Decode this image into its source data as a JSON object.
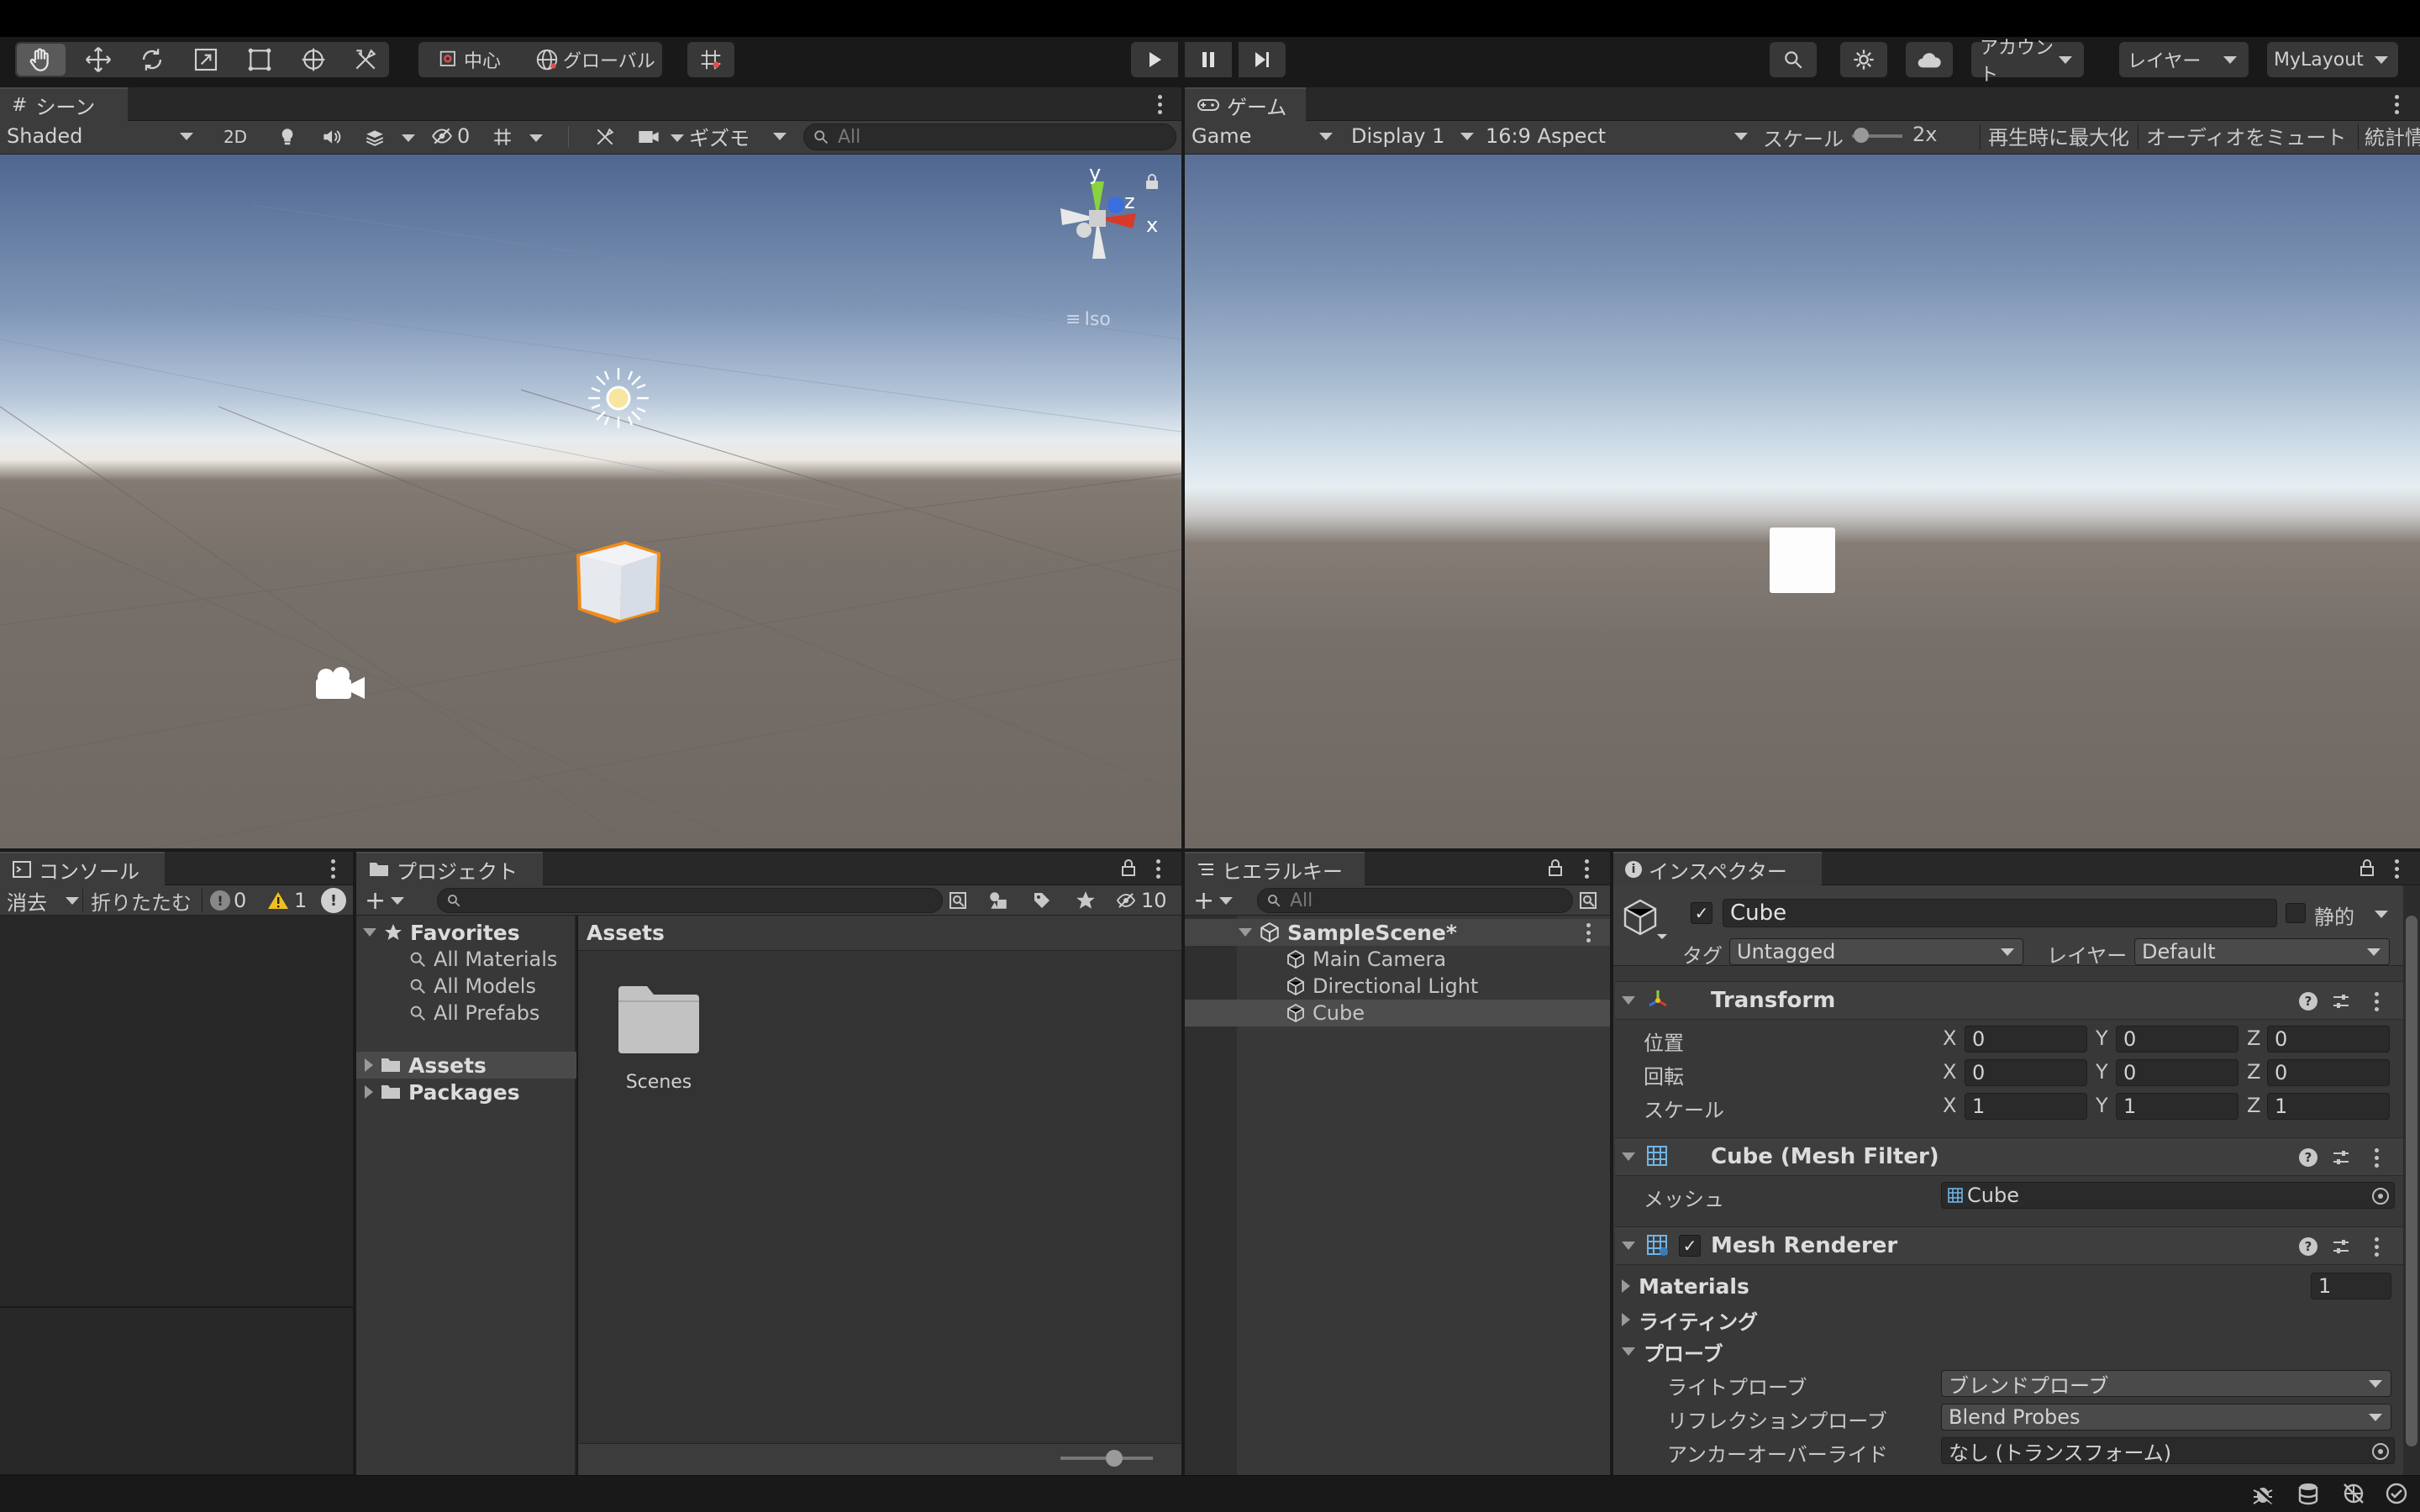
{
  "toolbar": {
    "pivot_label": "中心",
    "space_label": "グローバル",
    "account_label": "アカウント",
    "layers_label": "レイヤー",
    "layout_label": "MyLayout"
  },
  "scene": {
    "tab_label": "シーン",
    "shading_mode": "Shaded",
    "mode_2d": "2D",
    "hidden_count": "0",
    "gizmos_label": "ギズモ",
    "search_placeholder": "All",
    "gizmo_axes": {
      "x": "x",
      "y": "y",
      "z": "z"
    },
    "projection_label": "Iso"
  },
  "game": {
    "tab_label": "ゲーム",
    "view_label": "Game",
    "display_label": "Display 1",
    "aspect_label": "16:9 Aspect",
    "scale_label": "スケール",
    "scale_value": "2x",
    "maximize_label": "再生時に最大化",
    "mute_label": "オーディオをミュート",
    "stats_label": "統計情"
  },
  "console": {
    "tab_label": "コンソール",
    "clear_label": "消去",
    "collapse_label": "折りたたむ",
    "info_count": "0",
    "warning_count": "1"
  },
  "project": {
    "tab_label": "プロジェクト",
    "hidden_count": "10",
    "favorites_label": "Favorites",
    "favorites": [
      "All Materials",
      "All Models",
      "All Prefabs"
    ],
    "roots": [
      "Assets",
      "Packages"
    ],
    "breadcrumb": "Assets",
    "items": [
      {
        "name": "Scenes"
      }
    ]
  },
  "hierarchy": {
    "tab_label": "ヒエラルキー",
    "search_placeholder": "All",
    "scene_name": "SampleScene*",
    "objects": [
      "Main Camera",
      "Directional Light",
      "Cube"
    ]
  },
  "inspector": {
    "tab_label": "インスペクター",
    "object_name": "Cube",
    "static_label": "静的",
    "tag_label": "タグ",
    "tag_value": "Untagged",
    "layer_label": "レイヤー",
    "layer_value": "Default",
    "transform": {
      "title": "Transform",
      "position_label": "位置",
      "rotation_label": "回転",
      "scale_label": "スケール",
      "axes": [
        "X",
        "Y",
        "Z"
      ],
      "position": [
        "0",
        "0",
        "0"
      ],
      "rotation": [
        "0",
        "0",
        "0"
      ],
      "scale": [
        "1",
        "1",
        "1"
      ]
    },
    "mesh_filter": {
      "title": "Cube (Mesh Filter)",
      "mesh_label": "メッシュ",
      "mesh_value": "Cube"
    },
    "mesh_renderer": {
      "title": "Mesh Renderer",
      "materials_label": "Materials",
      "materials_count": "1",
      "lighting_label": "ライティング",
      "probes_label": "プローブ",
      "light_probes_label": "ライトプローブ",
      "light_probes_value": "ブレンドプローブ",
      "reflection_probes_label": "リフレクションプローブ",
      "reflection_probes_value": "Blend Probes",
      "anchor_override_label": "アンカーオーバーライド",
      "anchor_override_value": "なし (トランスフォーム)"
    }
  },
  "colors": {
    "accent_orange": "#f28c1a",
    "selection_blue": "#2c5d87",
    "axis_x": "#d83a2a",
    "axis_y": "#8ad23e",
    "axis_z": "#3b6fe0",
    "warning_yellow": "#f0c020"
  }
}
